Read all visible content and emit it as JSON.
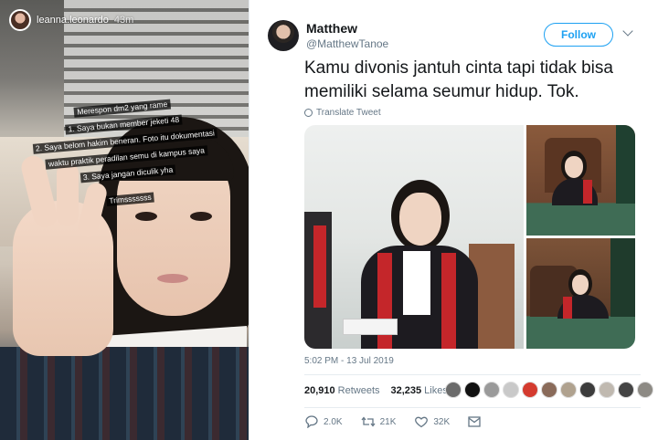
{
  "story": {
    "username": "leanna.leonardo",
    "time_ago": "43m",
    "caption_lines": [
      "Merespon dm2 yang rame",
      "1. Saya bukan member jeketi 48",
      "2. Saya belom hakim beneran. Foto itu dokumentasi",
      "waktu praktik peradilan semu di kampus saya",
      "3. Saya jangan diculik yha"
    ],
    "caption_thanks": "Trimsssssss"
  },
  "tweet": {
    "name": "Matthew",
    "handle": "@MatthewTanoe",
    "follow_label": "Follow",
    "text": "Kamu divonis jantuh cinta tapi tidak bisa memiliki selama seumur hidup. Tok.",
    "translate_label": "Translate Tweet",
    "timestamp": "5:02 PM - 13 Jul 2019",
    "retweets_count": "20,910",
    "retweets_label": "Retweets",
    "likes_count": "32,235",
    "likes_label": "Likes",
    "liker_colors": [
      "#6b6b6b",
      "#111111",
      "#9a9a9a",
      "#c9c9c9",
      "#d43b2f",
      "#8a6b5a",
      "#b0a28f",
      "#3c3c3c",
      "#c0b9b0",
      "#444444",
      "#8d8a84"
    ],
    "actions": {
      "reply_count": "2.0K",
      "retweet_count": "21K",
      "like_count": "32K"
    }
  },
  "colors": {
    "twitter_blue": "#1da1f2",
    "muted_text": "#657786"
  }
}
